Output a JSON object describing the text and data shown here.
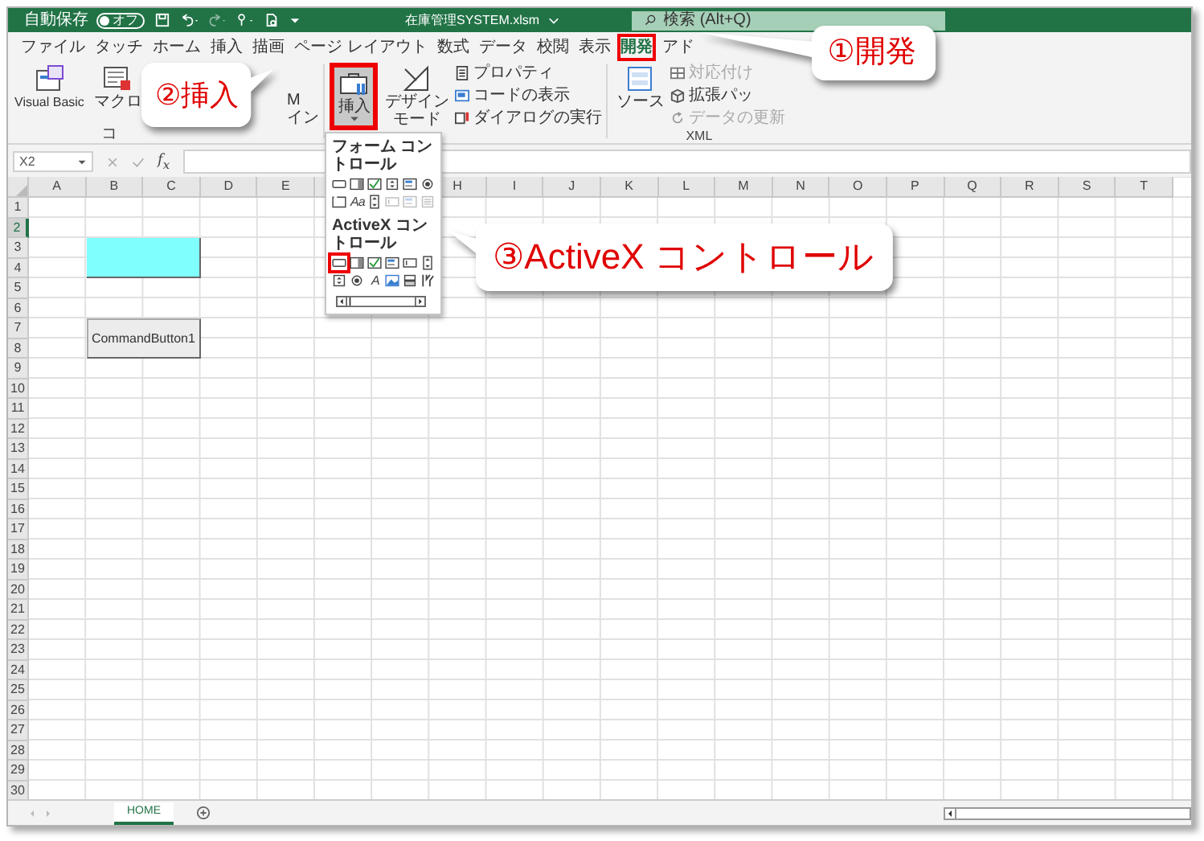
{
  "title_bar": {
    "autosave": {
      "label": "自動保存",
      "toggle_text": "オフ",
      "on": false
    },
    "file_name": "在庫管理SYSTEM.xlsm",
    "search": {
      "placeholder": "検索 (Alt+Q)"
    }
  },
  "ribbon_tabs": [
    {
      "label": "ファイル",
      "selected": false
    },
    {
      "label": "タッチ",
      "selected": false
    },
    {
      "label": "ホーム",
      "selected": false
    },
    {
      "label": "挿入",
      "selected": false
    },
    {
      "label": "描画",
      "selected": false
    },
    {
      "label": "ページ レイアウト",
      "selected": false
    },
    {
      "label": "数式",
      "selected": false
    },
    {
      "label": "データ",
      "selected": false
    },
    {
      "label": "校閲",
      "selected": false
    },
    {
      "label": "表示",
      "selected": false
    },
    {
      "label": "開発",
      "selected": true
    },
    {
      "label": "アド",
      "selected": false
    }
  ],
  "ribbon": {
    "code_group": {
      "label": "コ",
      "buttons": [
        {
          "kind": "visual-basic",
          "label": "Visual Basic"
        },
        {
          "kind": "macro",
          "label": "マクロ"
        }
      ],
      "clipped_button": [
        "M",
        "イン"
      ]
    },
    "controls_group": {
      "insert": {
        "label": "挿入",
        "pressed": true
      },
      "design_mode": {
        "lines": [
          "デザイン",
          "モード"
        ]
      },
      "small_buttons": [
        {
          "kind": "properties",
          "label": "プロパティ"
        },
        {
          "kind": "view-code",
          "label": "コードの表示"
        },
        {
          "kind": "run-dialog",
          "label": "ダイアログの実行"
        }
      ]
    },
    "xml_group": {
      "label": "XML",
      "source": {
        "label": "ソース"
      },
      "small_buttons": [
        {
          "kind": "map",
          "label": "対応付け",
          "disabled": true
        },
        {
          "kind": "expansion",
          "label": "拡張パッ",
          "disabled": false
        },
        {
          "kind": "refresh",
          "label": "データの更新",
          "disabled": true
        }
      ]
    }
  },
  "insert_menu": {
    "sections": [
      {
        "title": "フォーム コントロール",
        "controls": [
          {
            "kind": "button",
            "disabled": false,
            "selected": false
          },
          {
            "kind": "combo",
            "disabled": false,
            "selected": false
          },
          {
            "kind": "checkbox",
            "disabled": false,
            "selected": false
          },
          {
            "kind": "spin",
            "disabled": false,
            "selected": false
          },
          {
            "kind": "listbox",
            "disabled": false,
            "selected": false
          },
          {
            "kind": "option",
            "disabled": false,
            "selected": false
          },
          {
            "kind": "group",
            "disabled": false,
            "selected": false
          },
          {
            "kind": "glyph",
            "glyph": "Aa",
            "disabled": false,
            "selected": false
          },
          {
            "kind": "scrollbar",
            "disabled": false,
            "selected": false
          },
          {
            "kind": "textbox",
            "disabled": true,
            "selected": false
          },
          {
            "kind": "listbox",
            "disabled": true,
            "selected": false
          },
          {
            "kind": "combo-list",
            "disabled": true,
            "selected": false
          }
        ]
      },
      {
        "title": "ActiveX コントロール",
        "controls": [
          {
            "kind": "button",
            "disabled": false,
            "selected": true
          },
          {
            "kind": "combo",
            "disabled": false,
            "selected": false
          },
          {
            "kind": "checkbox",
            "disabled": false,
            "selected": false
          },
          {
            "kind": "listbox",
            "disabled": false,
            "selected": false
          },
          {
            "kind": "textbox",
            "disabled": false,
            "selected": false
          },
          {
            "kind": "scrollbar",
            "disabled": false,
            "selected": false
          },
          {
            "kind": "spin",
            "disabled": false,
            "selected": false
          },
          {
            "kind": "option",
            "disabled": false,
            "selected": false
          },
          {
            "kind": "glyph",
            "glyph": "A",
            "disabled": false,
            "selected": false
          },
          {
            "kind": "image",
            "disabled": false,
            "selected": false
          },
          {
            "kind": "toggle",
            "disabled": false,
            "selected": false
          },
          {
            "kind": "more",
            "disabled": false,
            "selected": false
          }
        ]
      }
    ]
  },
  "formula_bar": {
    "name_box": "X2",
    "function_label": "f$_{x}$"
  },
  "sheet": {
    "columns_left": [
      "A",
      "B",
      "C",
      "D",
      "E"
    ],
    "columns_right": [
      "H",
      "I",
      "J",
      "K",
      "L",
      "M",
      "N",
      "O",
      "P",
      "Q",
      "R",
      "S",
      "T"
    ],
    "rows": [
      {
        "label": "1",
        "selected": false
      },
      {
        "label": "2",
        "selected": true
      },
      {
        "label": "3",
        "selected": false
      },
      {
        "label": "4",
        "selected": false
      },
      {
        "label": "5",
        "selected": false
      },
      {
        "label": "6",
        "selected": false
      },
      {
        "label": "7",
        "selected": false
      },
      {
        "label": "8",
        "selected": false
      },
      {
        "label": "9",
        "selected": false
      },
      {
        "label": "10",
        "selected": false
      },
      {
        "label": "11",
        "selected": false
      },
      {
        "label": "12",
        "selected": false
      },
      {
        "label": "13",
        "selected": false
      },
      {
        "label": "14",
        "selected": false
      },
      {
        "label": "15",
        "selected": false
      },
      {
        "label": "16",
        "selected": false
      },
      {
        "label": "17",
        "selected": false
      },
      {
        "label": "18",
        "selected": false
      },
      {
        "label": "19",
        "selected": false
      },
      {
        "label": "20",
        "selected": false
      },
      {
        "label": "21",
        "selected": false
      },
      {
        "label": "22",
        "selected": false
      },
      {
        "label": "23",
        "selected": false
      },
      {
        "label": "24",
        "selected": false
      },
      {
        "label": "25",
        "selected": false
      },
      {
        "label": "26",
        "selected": false
      },
      {
        "label": "27",
        "selected": false
      },
      {
        "label": "28",
        "selected": false
      },
      {
        "label": "29",
        "selected": false
      },
      {
        "label": "30",
        "selected": false
      }
    ],
    "objects": [
      {
        "kind": "shape"
      },
      {
        "kind": "command-button",
        "label": "CommandButton1"
      }
    ]
  },
  "sheet_tabs": [
    {
      "label": "HOME",
      "selected": true
    }
  ],
  "callouts": [
    {
      "text": "①開発"
    },
    {
      "text": "②挿入"
    },
    {
      "text": "③ActiveX コントロール"
    }
  ]
}
